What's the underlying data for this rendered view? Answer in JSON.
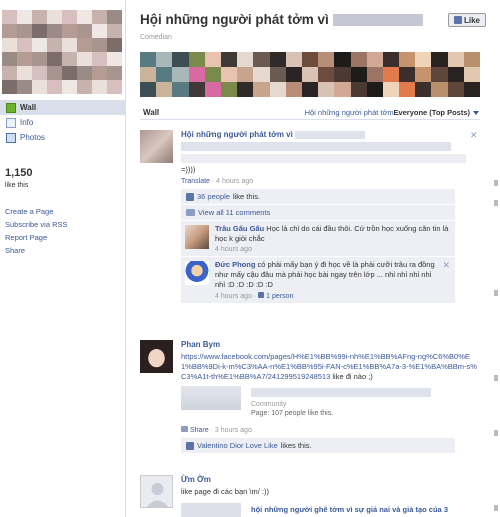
{
  "page": {
    "title": "Hội những người phát tởm vì",
    "category": "Comedian",
    "like_button": "Like"
  },
  "left_nav": {
    "items": [
      {
        "label": "Wall",
        "icon": "wall-icon",
        "active": true
      },
      {
        "label": "Info",
        "icon": "info-icon",
        "active": false
      },
      {
        "label": "Photos",
        "icon": "photos-icon",
        "active": false
      }
    ],
    "likes_count": "1,150",
    "likes_label": "like this",
    "links": [
      "Create a Page",
      "Subscribe via RSS",
      "Report Page",
      "Share"
    ]
  },
  "wall_bar": {
    "label": "Wall",
    "filter": "Hội những người phát tởm ...",
    "everyone": "Everyone (Top Posts)"
  },
  "posts": [
    {
      "author": "Hội những người phát tởm vì",
      "text_tail": "=))))",
      "translate": "Translate",
      "time": "4 hours ago",
      "likes_link": "36 people",
      "likes_text": " like this.",
      "view_all": "View all 11 comments",
      "comments": [
        {
          "name": "Trâu Gấu Gấu",
          "text": " Học là chỉ do cái đầu thôi. Cứ trồn học xuống căn tin là học k giỏi chắc",
          "time": "4 hours ago"
        },
        {
          "name": "Đức Phong",
          "text": " có phải mấy bạn ý đi học về là phải cưỡi trâu ra đồng như mấy cậu đâu mà phải học bài ngay trên lớp ... nhỉ nhỉ nhỉ nhỉ nhỉ :D :D :D :D :D",
          "time": "4 hours ago",
          "likes": "1 person"
        }
      ]
    },
    {
      "author": "Phan Bym",
      "url": "https://www.facebook.com/pages/H%E1%BB%99i-nh%E1%BB%AFng-ng%C6%B0%E1%BB%9Di-k-m%C3%AA-n%E1%BB%95i-FAN-c%E1%BB%A7a-3-%E1%BA%BBm-s%C3%A1t-th%E1%BB%A7/241299519248513",
      "url_tail": " like đi nào ;)",
      "share_type": "Community",
      "share_likes": "Page: 107 people like this.",
      "share": "Share",
      "time": "3 hours ago",
      "liker": "Valentino Dior Love Like",
      "liker_text": " likes this."
    },
    {
      "author": "Ừm Ờm",
      "text": "like page đi các bạn \\m/ :))",
      "link_title": "hội những người ghê tởm vì sự giả nai và giả tạo của 3"
    }
  ],
  "colors": {
    "link": "#3b5998",
    "ufi_bg": "#edeff4",
    "active_nav": "#d8dfea"
  }
}
